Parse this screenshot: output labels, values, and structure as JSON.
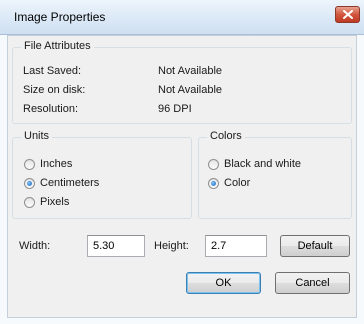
{
  "window": {
    "title": "Image Properties"
  },
  "file_attributes": {
    "group_label": "File Attributes",
    "rows": [
      {
        "label": "Last Saved:",
        "value": "Not Available"
      },
      {
        "label": "Size on disk:",
        "value": "Not Available"
      },
      {
        "label": "Resolution:",
        "value": "96 DPI"
      }
    ]
  },
  "units": {
    "group_label": "Units",
    "options": [
      "Inches",
      "Centimeters",
      "Pixels"
    ],
    "selected": "Centimeters"
  },
  "colors": {
    "group_label": "Colors",
    "options": [
      "Black and white",
      "Color"
    ],
    "selected": "Color"
  },
  "size": {
    "width_label": "Width:",
    "width_value": "5.30",
    "height_label": "Height:",
    "height_value": "2.7"
  },
  "buttons": {
    "default": "Default",
    "ok": "OK",
    "cancel": "Cancel"
  },
  "icons": {
    "close": "close-icon"
  },
  "colors_theme": {
    "accent": "#1b63b8",
    "close_button": "#c9452e",
    "title_bar": "#dbe8f6"
  }
}
